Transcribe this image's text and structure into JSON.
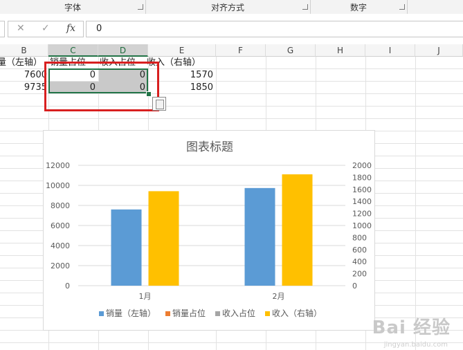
{
  "ribbon": {
    "groups": [
      "字体",
      "对齐方式",
      "数字"
    ]
  },
  "formula_bar": {
    "cancel_icon": "✕",
    "enter_icon": "✓",
    "fx_label": "fx",
    "value": "0"
  },
  "columns": [
    "B",
    "C",
    "D",
    "E",
    "F",
    "G",
    "H",
    "I",
    "J"
  ],
  "rows": [
    {
      "B": "量（左轴）",
      "C": "销量占位",
      "D": "收入占位",
      "E": "收入（右轴）"
    },
    {
      "B": "7600",
      "C": "0",
      "D": "0",
      "E": "1570"
    },
    {
      "B": "9735",
      "C": "0",
      "D": "0",
      "E": "1850"
    }
  ],
  "chart_data": {
    "type": "bar",
    "title": "图表标题",
    "categories": [
      "1月",
      "2月"
    ],
    "series": [
      {
        "name": "销量（左轴）",
        "values": [
          7600,
          9735
        ],
        "axis": "left",
        "color": "#5b9bd5"
      },
      {
        "name": "销量占位",
        "values": [
          0,
          0
        ],
        "axis": "left",
        "color": "#ed7d31"
      },
      {
        "name": "收入占位",
        "values": [
          0,
          0
        ],
        "axis": "right",
        "color": "#a5a5a5"
      },
      {
        "name": "收入（右轴）",
        "values": [
          1570,
          1850
        ],
        "axis": "right",
        "color": "#ffc000"
      }
    ],
    "y_left": {
      "min": 0,
      "max": 12000,
      "ticks": [
        0,
        2000,
        4000,
        6000,
        8000,
        10000,
        12000
      ]
    },
    "y_right": {
      "min": 0,
      "max": 2000,
      "ticks": [
        0,
        200,
        400,
        600,
        800,
        1000,
        1200,
        1400,
        1600,
        1800,
        2000
      ]
    },
    "grid": true,
    "legend": "bottom"
  },
  "watermark": {
    "text": "Bai 经验",
    "sub": "jingyan.baidu.com"
  }
}
